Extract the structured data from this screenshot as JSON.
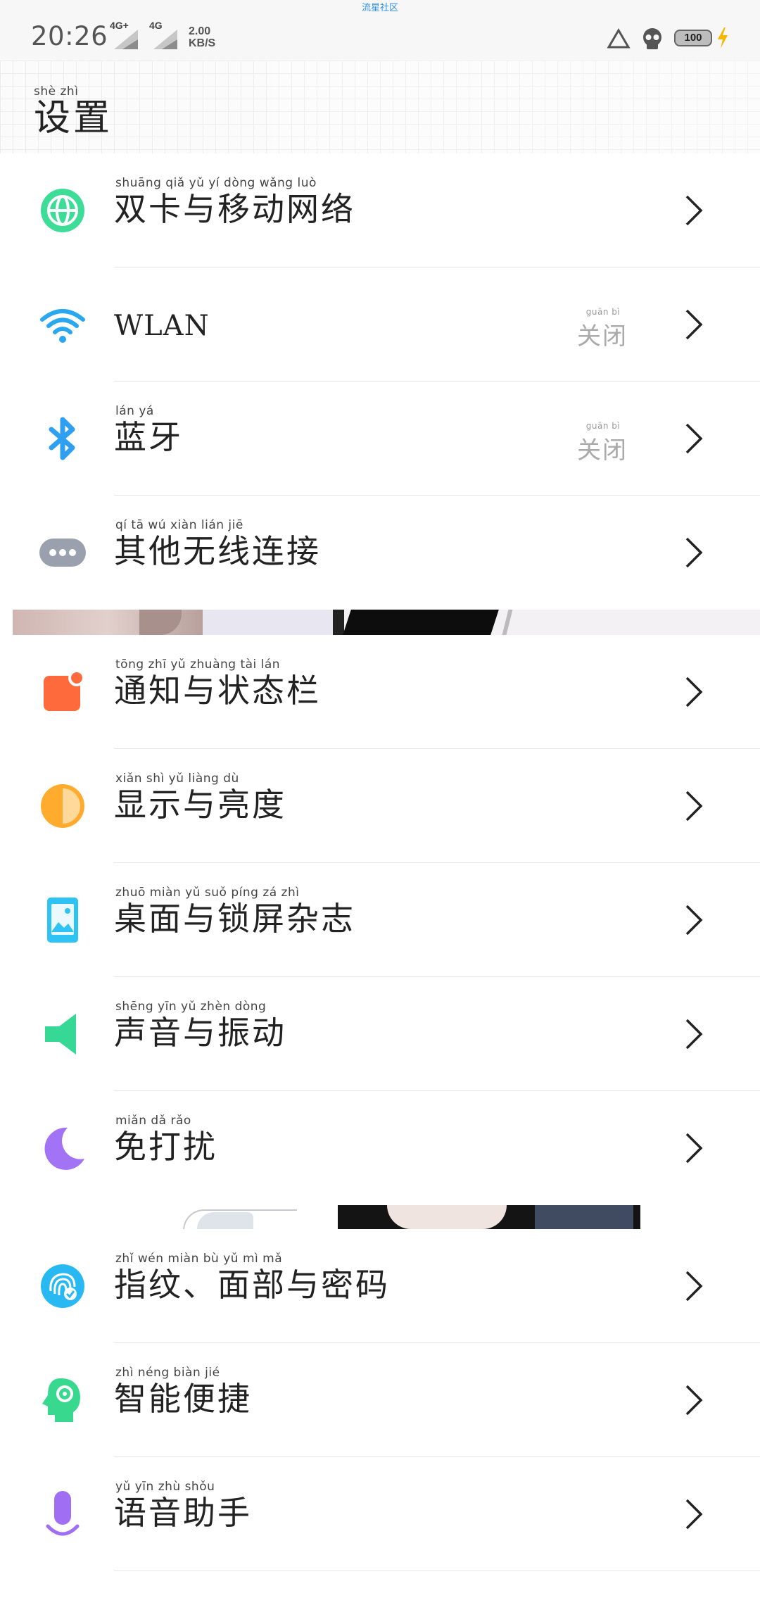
{
  "status_bar": {
    "carrier_tip": "流星社区",
    "time": "20:26",
    "signal_1_type": "4G+",
    "signal_2_type": "4G",
    "net_speed_value": "2.00",
    "net_speed_unit": "KB/S",
    "battery_level": "100"
  },
  "header": {
    "title_pinyin": "shè  zhì",
    "title": "设置"
  },
  "settings": [
    {
      "pinyin": "shuāng qiǎ  yǔ   yí  dòng wǎng luò",
      "label": "双卡与移动网络",
      "status": null,
      "status_pinyin": null
    },
    {
      "pinyin": "",
      "label": "WLAN",
      "status": "关闭",
      "status_pinyin": "guān  bì"
    },
    {
      "pinyin": "lán   yá",
      "label": "蓝牙",
      "status": "关闭",
      "status_pinyin": "guān  bì"
    },
    {
      "pinyin": "qí   tā   wú  xiàn  lián  jiē",
      "label": "其他无线连接",
      "status": null,
      "status_pinyin": null
    },
    {
      "pinyin": "tōng  zhī   yǔ zhuàng tài   lán",
      "label": "通知与状态栏",
      "status": null,
      "status_pinyin": null
    },
    {
      "pinyin": "xiǎn  shì   yǔ  liàng  dù",
      "label": "显示与亮度",
      "status": null,
      "status_pinyin": null
    },
    {
      "pinyin": "zhuō miàn  yǔ  suǒ  píng   zá   zhì",
      "label": "桌面与锁屏杂志",
      "status": null,
      "status_pinyin": null
    },
    {
      "pinyin": "shēng  yīn   yǔ  zhèn  dòng",
      "label": "声音与振动",
      "status": null,
      "status_pinyin": null
    },
    {
      "pinyin": "miǎn   dǎ   rǎo",
      "label": "免打扰",
      "status": null,
      "status_pinyin": null
    },
    {
      "pinyin": "zhǐ   wén      miàn  bù   yǔ   mì   mǎ",
      "label": "指纹、面部与密码",
      "status": null,
      "status_pinyin": null
    },
    {
      "pinyin": "zhì  néng  biàn   jié",
      "label": "智能便捷",
      "status": null,
      "status_pinyin": null
    },
    {
      "pinyin": "yǔ   yīn   zhù  shǒu",
      "label": "语音助手",
      "status": null,
      "status_pinyin": null
    }
  ],
  "icons": {
    "row_0": "globe-icon",
    "row_1": "wifi-icon",
    "row_2": "bluetooth-icon",
    "row_3": "more-dots-icon",
    "row_4": "notification-icon",
    "row_5": "brightness-icon",
    "row_6": "wallpaper-icon",
    "row_7": "speaker-icon",
    "row_8": "moon-icon",
    "row_9": "fingerprint-face-icon",
    "row_10": "smart-head-gear-icon",
    "row_11": "microphone-icon"
  },
  "colors": {
    "globe": "#3ddc97",
    "wifi": "#29a8f0",
    "bluetooth": "#2f9ff2",
    "dots": "#9aa0ad",
    "notification": "#ff6a3d",
    "brightness": "#ffab2e",
    "wallpaper": "#2fc3f5",
    "speaker": "#36d895",
    "moon": "#a274f5",
    "fingerprint": "#29b9f2",
    "smart": "#38d98e",
    "mic": "#9f6ef2",
    "charging": "#f5b800"
  }
}
